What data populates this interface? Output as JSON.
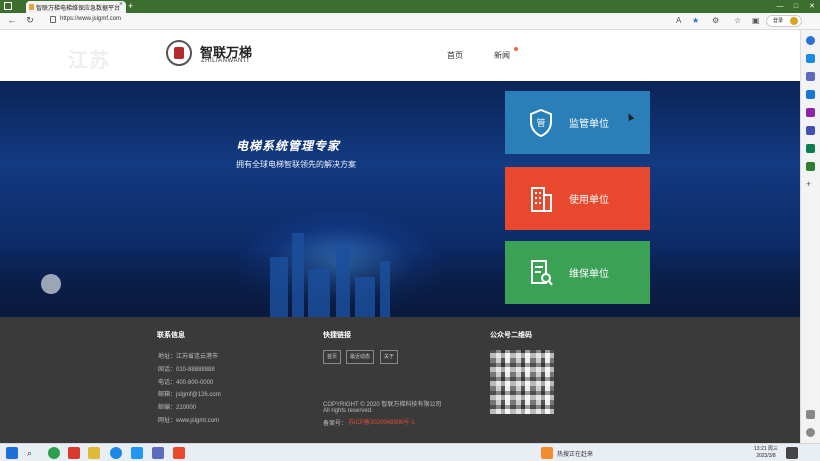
{
  "browser": {
    "tab_title": "智联万梯电梯维保应急数据平台",
    "tab_close": "×",
    "new_tab": "+",
    "url": "https://www.jslgmf.com",
    "signin_label": "登录",
    "window_controls": [
      "—",
      "□",
      "✕"
    ]
  },
  "header": {
    "watermark": "江苏",
    "logo_cn": "智联万梯",
    "logo_en": "ZHILIANWANTI",
    "nav": {
      "home": "首页",
      "news": "新闻"
    }
  },
  "hero": {
    "title": "电梯系统管理专家",
    "subtitle": "拥有全球电梯智联领先的解决方案"
  },
  "cards": {
    "supervise": {
      "label": "监管单位",
      "icon_char": "管",
      "color": "#2a7fb8"
    },
    "use": {
      "label": "使用单位",
      "color": "#e8492e"
    },
    "maint": {
      "label": "维保单位",
      "color": "#3ba155"
    }
  },
  "footer": {
    "contact_title": "联系信息",
    "contact_lines": [
      "地址：江苏省连云港市",
      "固话：010-88888888",
      "电话：400-800-0000",
      "邮箱：jslgmf@126.com",
      "邮编：210000",
      "网址：www.jslgmt.com"
    ],
    "links_title": "快捷链接",
    "links": [
      "首页",
      "最近动态",
      "关于"
    ],
    "copyright": "COPYRIGHT © 2020 智联万梯科技有限公司",
    "rights": "All rights reserved.",
    "icp_label": "备案号：",
    "icp": "苏ICP备2020048906号-1",
    "qr_title": "公众号二维码"
  },
  "taskbar": {
    "weather_text": "热搜正在赶来",
    "time": "13:21 周三",
    "date": "2023/3/8"
  }
}
